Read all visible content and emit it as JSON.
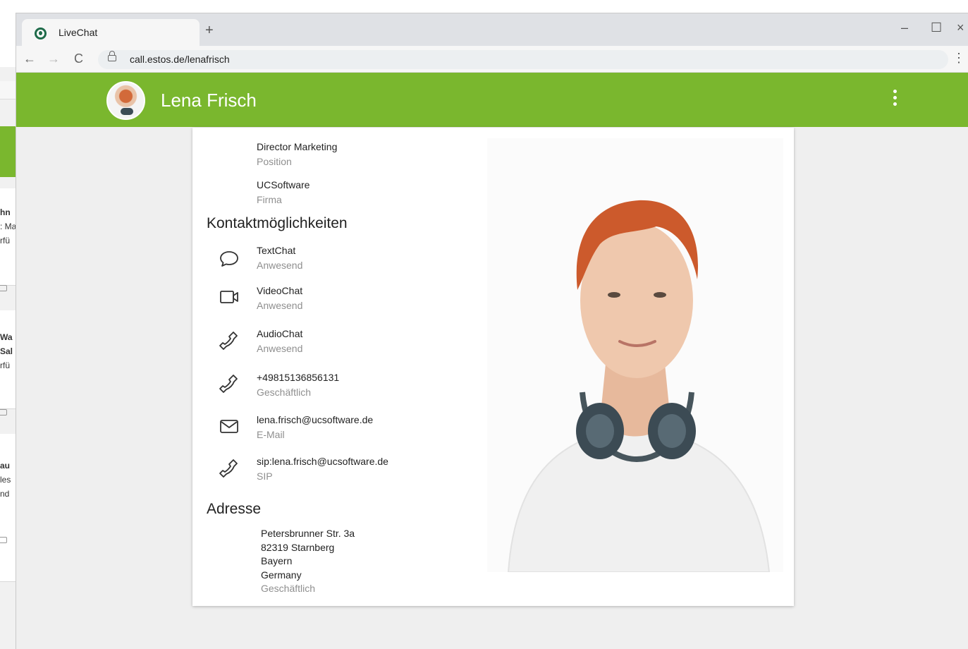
{
  "background_window": {
    "lines": [
      "hn",
      ": Ma",
      "rfü",
      "Wa",
      "Sal",
      "rfü",
      "au",
      "les",
      "nd"
    ]
  },
  "browser": {
    "tab_title": "LiveChat",
    "new_tab": "+",
    "controls": {
      "minimize": "–",
      "maximize": "☐",
      "close": "×"
    },
    "nav": {
      "back": "←",
      "forward": "→",
      "reload": "C"
    },
    "url": "call.estos.de/lenafrisch",
    "menu": "⋮"
  },
  "appbar": {
    "name": "Lena Frisch",
    "accent_color": "#7ab72e"
  },
  "profile": {
    "fields": [
      {
        "value": "Director Marketing",
        "label": "Position"
      },
      {
        "value": "UCSoftware",
        "label": "Firma"
      }
    ],
    "contact_heading": "Kontaktmöglichkeiten",
    "contacts": [
      {
        "icon": "chat-bubble-icon",
        "value": "TextChat",
        "label": "Anwesend"
      },
      {
        "icon": "video-camera-icon",
        "value": "VideoChat",
        "label": "Anwesend"
      },
      {
        "icon": "phone-icon",
        "value": "AudioChat",
        "label": "Anwesend"
      },
      {
        "icon": "phone-icon",
        "value": "+49815136856131",
        "label": "Geschäftlich"
      },
      {
        "icon": "mail-icon",
        "value": "lena.frisch@ucsoftware.de",
        "label": "E-Mail"
      },
      {
        "icon": "phone-icon",
        "value": "sip:lena.frisch@ucsoftware.de",
        "label": "SIP"
      }
    ],
    "address_heading": "Adresse",
    "address": {
      "street": "Petersbrunner Str. 3a",
      "city": "82319 Starnberg",
      "region": "Bayern",
      "country": "Germany",
      "type": "Geschäftlich"
    }
  }
}
